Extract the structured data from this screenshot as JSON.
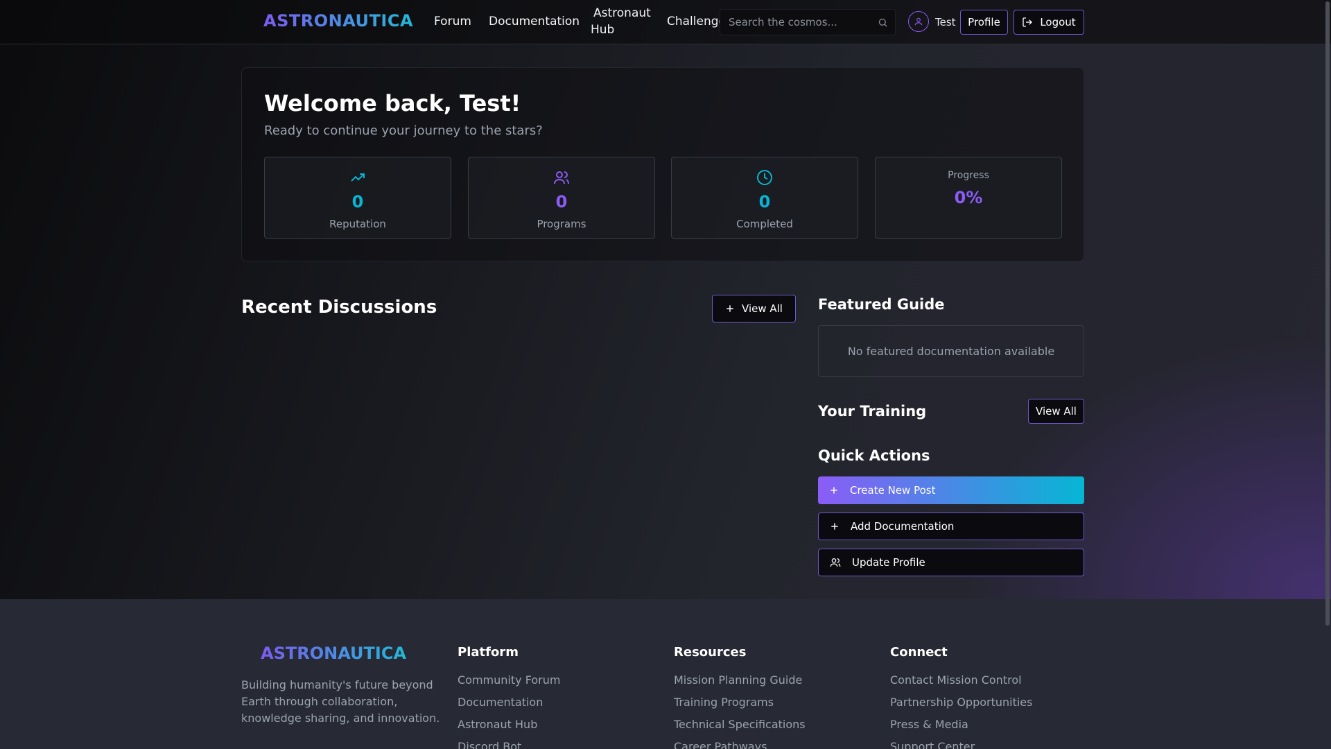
{
  "header": {
    "logo": "ASTRONAUTICA",
    "nav": [
      "Forum",
      "Documentation",
      "Astronaut",
      "Hub",
      "Challenges"
    ],
    "search_placeholder": "Search the cosmos...",
    "user_name": "Test",
    "profile_label": "Profile",
    "logout_label": "Logout"
  },
  "welcome": {
    "title": "Welcome back, Test!",
    "subtitle": "Ready to continue your journey to the stars?",
    "stats": [
      {
        "value": "0",
        "label": "Reputation",
        "icon": "trending-up-icon",
        "color": "#06b6d4"
      },
      {
        "value": "0",
        "label": "Programs",
        "icon": "users-icon",
        "color": "#8b5cf6"
      },
      {
        "value": "0",
        "label": "Completed",
        "icon": "clock-icon",
        "color": "#06b6d4"
      }
    ],
    "progress": {
      "title": "Progress",
      "value": "0%"
    }
  },
  "discussions": {
    "title": "Recent Discussions",
    "view_all": "View All"
  },
  "featured": {
    "title": "Featured Guide",
    "empty": "No featured documentation available"
  },
  "training": {
    "title": "Your Training",
    "view_all": "View All"
  },
  "quick_actions": {
    "title": "Quick Actions",
    "create_post": "Create New Post",
    "add_doc": "Add Documentation",
    "update_profile": "Update Profile"
  },
  "footer": {
    "logo": "ASTRONAUTICA",
    "description": "Building humanity's future beyond Earth through collaboration, knowledge sharing, and innovation.",
    "columns": [
      {
        "title": "Platform",
        "links": [
          "Community Forum",
          "Documentation",
          "Astronaut Hub",
          "Discord Bot"
        ]
      },
      {
        "title": "Resources",
        "links": [
          "Mission Planning Guide",
          "Training Programs",
          "Technical Specifications",
          "Career Pathways"
        ]
      },
      {
        "title": "Connect",
        "links": [
          "Contact Mission Control",
          "Partnership Opportunities",
          "Press & Media",
          "Support Center"
        ]
      }
    ]
  },
  "colors": {
    "accent_purple": "#8b5cf6",
    "accent_cyan": "#06b6d4",
    "border_purple": "#6d5bd0"
  }
}
